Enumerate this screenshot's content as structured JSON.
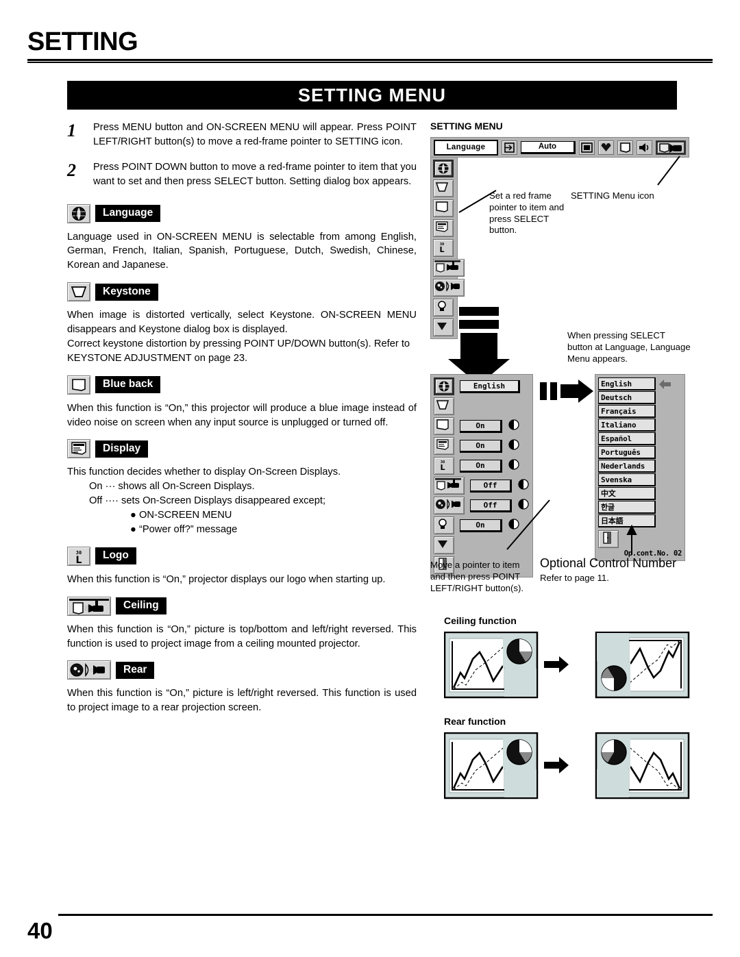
{
  "header": {
    "chapter": "SETTING"
  },
  "title_bar": {
    "title": "SETTING MENU"
  },
  "steps": [
    {
      "num": "1",
      "text": "Press MENU button and ON-SCREEN MENU will appear.  Press POINT LEFT/RIGHT button(s) to move a red-frame pointer to SETTING icon."
    },
    {
      "num": "2",
      "text": "Press POINT DOWN button to move a red-frame pointer to item that you want to set and then press SELECT button.  Setting dialog box appears."
    }
  ],
  "sections": [
    {
      "id": "language",
      "label": "Language",
      "icon": "globe-icon",
      "body": "Language used in ON-SCREEN MENU is selectable from among English, German, French, Italian, Spanish, Portuguese, Dutch, Swedish, Chinese, Korean and Japanese."
    },
    {
      "id": "keystone",
      "label": "Keystone",
      "icon": "keystone-icon",
      "body": "When image is distorted vertically, select Keystone.  ON-SCREEN MENU disappears and Keystone dialog box is displayed.",
      "body2": "Correct keystone distortion by pressing POINT UP/DOWN button(s). Refer to KEYSTONE ADJUSTMENT on page 23."
    },
    {
      "id": "blue-back",
      "label": "Blue back",
      "icon": "blue-back-icon",
      "body": "When this function is “On,” this projector will produce a blue image instead of video noise on screen when any input source is unplugged or turned off."
    },
    {
      "id": "display",
      "label": "Display",
      "icon": "display-icon",
      "body": "This function decides whether to display On-Screen Displays.",
      "on_line": "On  ··· shows all On-Screen Displays.",
      "off_line": "Off ···· sets On-Screen Displays disappeared except;",
      "bullets": [
        "● ON-SCREEN MENU",
        "● “Power off?” message"
      ]
    },
    {
      "id": "logo",
      "label": "Logo",
      "icon": "logo-icon",
      "body": "When this function is “On,” projector displays our logo when starting up."
    },
    {
      "id": "ceiling",
      "label": "Ceiling",
      "icon": "ceiling-icon",
      "body": "When this function is “On,” picture is top/bottom and left/right reversed. This function is used to project image from a ceiling mounted projector."
    },
    {
      "id": "rear",
      "label": "Rear",
      "icon": "rear-icon",
      "body": "When this function is “On,” picture is left/right reversed.  This function is used to project image to a rear projection screen."
    }
  ],
  "right": {
    "menu_heading": "SETTING MENU",
    "menu_bar": {
      "lang_label": "Language",
      "auto_label": "Auto",
      "icons": [
        "input-icon",
        "screen-icon",
        "color-icon",
        "image-icon",
        "sound-icon",
        "setting-icon"
      ]
    },
    "callout_pointer": "Set a red frame pointer to item and press SELECT button.",
    "callout_setting_icon": "SETTING Menu icon",
    "callout_select": "When pressing SELECT button at Language, Language Menu appears.",
    "dialog_rows": [
      {
        "icon": "globe-icon",
        "value": "English"
      },
      {
        "icon": "keystone-icon",
        "value": ""
      },
      {
        "icon": "blue-back-icon",
        "value": "On"
      },
      {
        "icon": "display-icon",
        "value": "On"
      },
      {
        "icon": "logo-icon",
        "value": "On"
      },
      {
        "icon": "ceiling-icon",
        "value": "Off"
      },
      {
        "icon": "rear-icon",
        "value": "Off"
      },
      {
        "icon": "lamp-icon",
        "value": "On"
      },
      {
        "icon": "scroll-down-icon",
        "value": ""
      },
      {
        "icon": "exit-icon",
        "value": ""
      }
    ],
    "languages": [
      "English",
      "Deutsch",
      "Français",
      "Italiano",
      "Español",
      "Português",
      "Nederlands",
      "Svenska",
      "中文",
      "한글",
      "日本語"
    ],
    "op_control_number": "Op.cont.No. 02",
    "callout_move": "Move a pointer to item and then press POINT LEFT/RIGHT button(s).",
    "optional_title": "Optional Control Number",
    "optional_sub": "Refer to page 11.",
    "ceiling_function_title": "Ceiling function",
    "rear_function_title": "Rear function"
  },
  "footer": {
    "page_number": "40"
  }
}
